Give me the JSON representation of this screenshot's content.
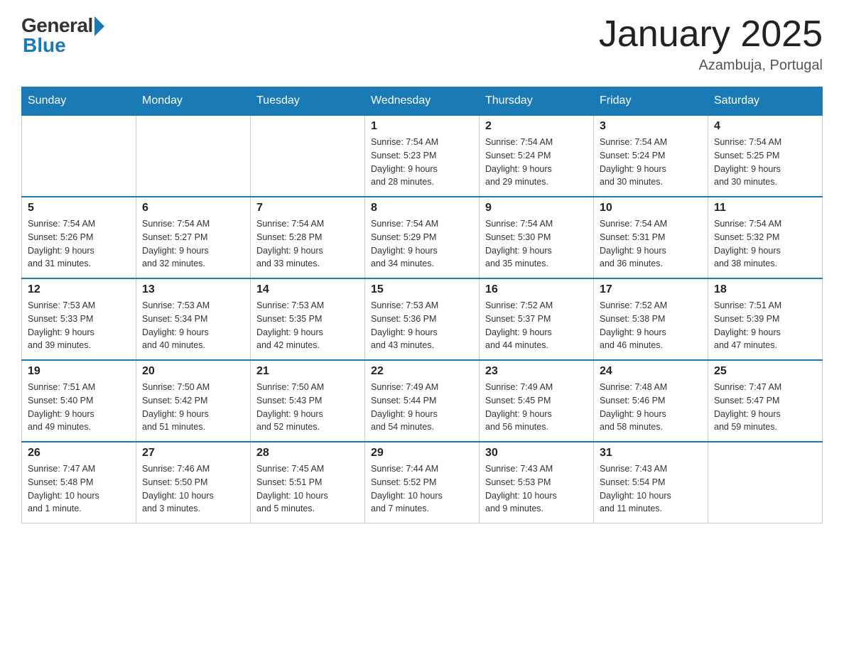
{
  "logo": {
    "general": "General",
    "blue": "Blue"
  },
  "title": "January 2025",
  "subtitle": "Azambuja, Portugal",
  "days": [
    "Sunday",
    "Monday",
    "Tuesday",
    "Wednesday",
    "Thursday",
    "Friday",
    "Saturday"
  ],
  "weeks": [
    [
      {
        "day": "",
        "info": ""
      },
      {
        "day": "",
        "info": ""
      },
      {
        "day": "",
        "info": ""
      },
      {
        "day": "1",
        "info": "Sunrise: 7:54 AM\nSunset: 5:23 PM\nDaylight: 9 hours\nand 28 minutes."
      },
      {
        "day": "2",
        "info": "Sunrise: 7:54 AM\nSunset: 5:24 PM\nDaylight: 9 hours\nand 29 minutes."
      },
      {
        "day": "3",
        "info": "Sunrise: 7:54 AM\nSunset: 5:24 PM\nDaylight: 9 hours\nand 30 minutes."
      },
      {
        "day": "4",
        "info": "Sunrise: 7:54 AM\nSunset: 5:25 PM\nDaylight: 9 hours\nand 30 minutes."
      }
    ],
    [
      {
        "day": "5",
        "info": "Sunrise: 7:54 AM\nSunset: 5:26 PM\nDaylight: 9 hours\nand 31 minutes."
      },
      {
        "day": "6",
        "info": "Sunrise: 7:54 AM\nSunset: 5:27 PM\nDaylight: 9 hours\nand 32 minutes."
      },
      {
        "day": "7",
        "info": "Sunrise: 7:54 AM\nSunset: 5:28 PM\nDaylight: 9 hours\nand 33 minutes."
      },
      {
        "day": "8",
        "info": "Sunrise: 7:54 AM\nSunset: 5:29 PM\nDaylight: 9 hours\nand 34 minutes."
      },
      {
        "day": "9",
        "info": "Sunrise: 7:54 AM\nSunset: 5:30 PM\nDaylight: 9 hours\nand 35 minutes."
      },
      {
        "day": "10",
        "info": "Sunrise: 7:54 AM\nSunset: 5:31 PM\nDaylight: 9 hours\nand 36 minutes."
      },
      {
        "day": "11",
        "info": "Sunrise: 7:54 AM\nSunset: 5:32 PM\nDaylight: 9 hours\nand 38 minutes."
      }
    ],
    [
      {
        "day": "12",
        "info": "Sunrise: 7:53 AM\nSunset: 5:33 PM\nDaylight: 9 hours\nand 39 minutes."
      },
      {
        "day": "13",
        "info": "Sunrise: 7:53 AM\nSunset: 5:34 PM\nDaylight: 9 hours\nand 40 minutes."
      },
      {
        "day": "14",
        "info": "Sunrise: 7:53 AM\nSunset: 5:35 PM\nDaylight: 9 hours\nand 42 minutes."
      },
      {
        "day": "15",
        "info": "Sunrise: 7:53 AM\nSunset: 5:36 PM\nDaylight: 9 hours\nand 43 minutes."
      },
      {
        "day": "16",
        "info": "Sunrise: 7:52 AM\nSunset: 5:37 PM\nDaylight: 9 hours\nand 44 minutes."
      },
      {
        "day": "17",
        "info": "Sunrise: 7:52 AM\nSunset: 5:38 PM\nDaylight: 9 hours\nand 46 minutes."
      },
      {
        "day": "18",
        "info": "Sunrise: 7:51 AM\nSunset: 5:39 PM\nDaylight: 9 hours\nand 47 minutes."
      }
    ],
    [
      {
        "day": "19",
        "info": "Sunrise: 7:51 AM\nSunset: 5:40 PM\nDaylight: 9 hours\nand 49 minutes."
      },
      {
        "day": "20",
        "info": "Sunrise: 7:50 AM\nSunset: 5:42 PM\nDaylight: 9 hours\nand 51 minutes."
      },
      {
        "day": "21",
        "info": "Sunrise: 7:50 AM\nSunset: 5:43 PM\nDaylight: 9 hours\nand 52 minutes."
      },
      {
        "day": "22",
        "info": "Sunrise: 7:49 AM\nSunset: 5:44 PM\nDaylight: 9 hours\nand 54 minutes."
      },
      {
        "day": "23",
        "info": "Sunrise: 7:49 AM\nSunset: 5:45 PM\nDaylight: 9 hours\nand 56 minutes."
      },
      {
        "day": "24",
        "info": "Sunrise: 7:48 AM\nSunset: 5:46 PM\nDaylight: 9 hours\nand 58 minutes."
      },
      {
        "day": "25",
        "info": "Sunrise: 7:47 AM\nSunset: 5:47 PM\nDaylight: 9 hours\nand 59 minutes."
      }
    ],
    [
      {
        "day": "26",
        "info": "Sunrise: 7:47 AM\nSunset: 5:48 PM\nDaylight: 10 hours\nand 1 minute."
      },
      {
        "day": "27",
        "info": "Sunrise: 7:46 AM\nSunset: 5:50 PM\nDaylight: 10 hours\nand 3 minutes."
      },
      {
        "day": "28",
        "info": "Sunrise: 7:45 AM\nSunset: 5:51 PM\nDaylight: 10 hours\nand 5 minutes."
      },
      {
        "day": "29",
        "info": "Sunrise: 7:44 AM\nSunset: 5:52 PM\nDaylight: 10 hours\nand 7 minutes."
      },
      {
        "day": "30",
        "info": "Sunrise: 7:43 AM\nSunset: 5:53 PM\nDaylight: 10 hours\nand 9 minutes."
      },
      {
        "day": "31",
        "info": "Sunrise: 7:43 AM\nSunset: 5:54 PM\nDaylight: 10 hours\nand 11 minutes."
      },
      {
        "day": "",
        "info": ""
      }
    ]
  ]
}
